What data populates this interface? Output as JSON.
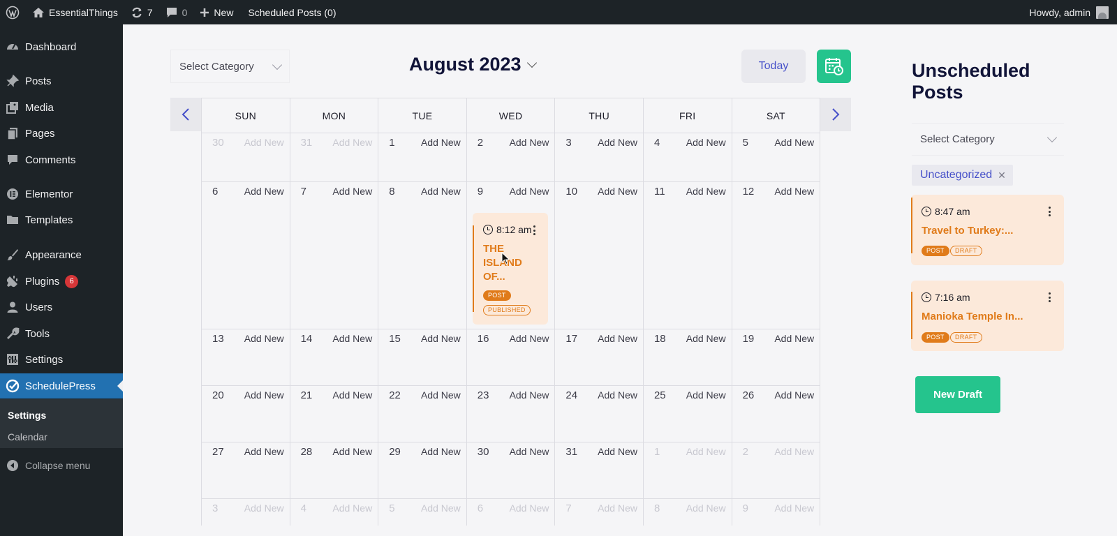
{
  "adminbar": {
    "site_name": "EssentialThings",
    "updates_count": "7",
    "comments_count": "0",
    "new_label": "New",
    "scheduled_label": "Scheduled Posts (0)",
    "howdy": "Howdy, admin"
  },
  "sidebar": {
    "items": [
      {
        "label": "Dashboard",
        "icon": "dashboard-icon"
      },
      {
        "label": "Posts",
        "icon": "pin-icon"
      },
      {
        "label": "Media",
        "icon": "media-icon"
      },
      {
        "label": "Pages",
        "icon": "pages-icon"
      },
      {
        "label": "Comments",
        "icon": "comment-icon"
      },
      {
        "label": "Elementor",
        "icon": "elementor-icon"
      },
      {
        "label": "Templates",
        "icon": "folder-icon"
      },
      {
        "label": "Appearance",
        "icon": "brush-icon"
      },
      {
        "label": "Plugins",
        "icon": "plugin-icon",
        "badge": "6"
      },
      {
        "label": "Users",
        "icon": "user-icon"
      },
      {
        "label": "Tools",
        "icon": "wrench-icon"
      },
      {
        "label": "Settings",
        "icon": "settings-icon"
      },
      {
        "label": "SchedulePress",
        "icon": "schedulepress-icon"
      }
    ],
    "submenu": [
      "Settings",
      "Calendar"
    ],
    "collapse_label": "Collapse menu"
  },
  "calendar": {
    "category_placeholder": "Select Category",
    "month_title": "August 2023",
    "today_label": "Today",
    "weekdays": [
      "SUN",
      "MON",
      "TUE",
      "WED",
      "THU",
      "FRI",
      "SAT"
    ],
    "add_new_label": "Add New",
    "weeks": [
      [
        {
          "d": "30",
          "other": true
        },
        {
          "d": "31",
          "other": true
        },
        {
          "d": "1"
        },
        {
          "d": "2"
        },
        {
          "d": "3"
        },
        {
          "d": "4"
        },
        {
          "d": "5"
        }
      ],
      [
        {
          "d": "6"
        },
        {
          "d": "7"
        },
        {
          "d": "8"
        },
        {
          "d": "9"
        },
        {
          "d": "10"
        },
        {
          "d": "11"
        },
        {
          "d": "12"
        }
      ],
      [
        {
          "d": "13"
        },
        {
          "d": "14"
        },
        {
          "d": "15"
        },
        {
          "d": "16"
        },
        {
          "d": "17"
        },
        {
          "d": "18"
        },
        {
          "d": "19"
        }
      ],
      [
        {
          "d": "20"
        },
        {
          "d": "21"
        },
        {
          "d": "22"
        },
        {
          "d": "23"
        },
        {
          "d": "24"
        },
        {
          "d": "25"
        },
        {
          "d": "26"
        }
      ],
      [
        {
          "d": "27"
        },
        {
          "d": "28"
        },
        {
          "d": "29"
        },
        {
          "d": "30"
        },
        {
          "d": "31"
        },
        {
          "d": "1",
          "other": true
        },
        {
          "d": "2",
          "other": true
        }
      ],
      [
        {
          "d": "3",
          "other": true
        },
        {
          "d": "4",
          "other": true
        },
        {
          "d": "5",
          "other": true
        },
        {
          "d": "6",
          "other": true
        },
        {
          "d": "7",
          "other": true
        },
        {
          "d": "8",
          "other": true
        },
        {
          "d": "9",
          "other": true
        }
      ]
    ],
    "event": {
      "time": "8:12 am",
      "title_lines": [
        "THE",
        "ISLAND",
        "OF..."
      ],
      "type_tag": "POST",
      "status_tag": "PUBLISHED"
    }
  },
  "unscheduled": {
    "title_line1": "Unscheduled",
    "title_line2": "Posts",
    "category_placeholder": "Select Category",
    "filter_chip": "Uncategorized",
    "posts": [
      {
        "time": "8:47 am",
        "title": "Travel to Turkey:...",
        "type_tag": "POST",
        "status_tag": "DRAFT"
      },
      {
        "time": "7:16 am",
        "title": "Manioka Temple In...",
        "type_tag": "POST",
        "status_tag": "DRAFT"
      }
    ],
    "new_draft_label": "New Draft"
  },
  "colors": {
    "accent_green": "#25c48d",
    "accent_blue": "#4650c9",
    "post_orange": "#e07b1a",
    "card_bg": "#fce9da",
    "wp_dark": "#1d2327",
    "wp_active": "#2271b1"
  }
}
